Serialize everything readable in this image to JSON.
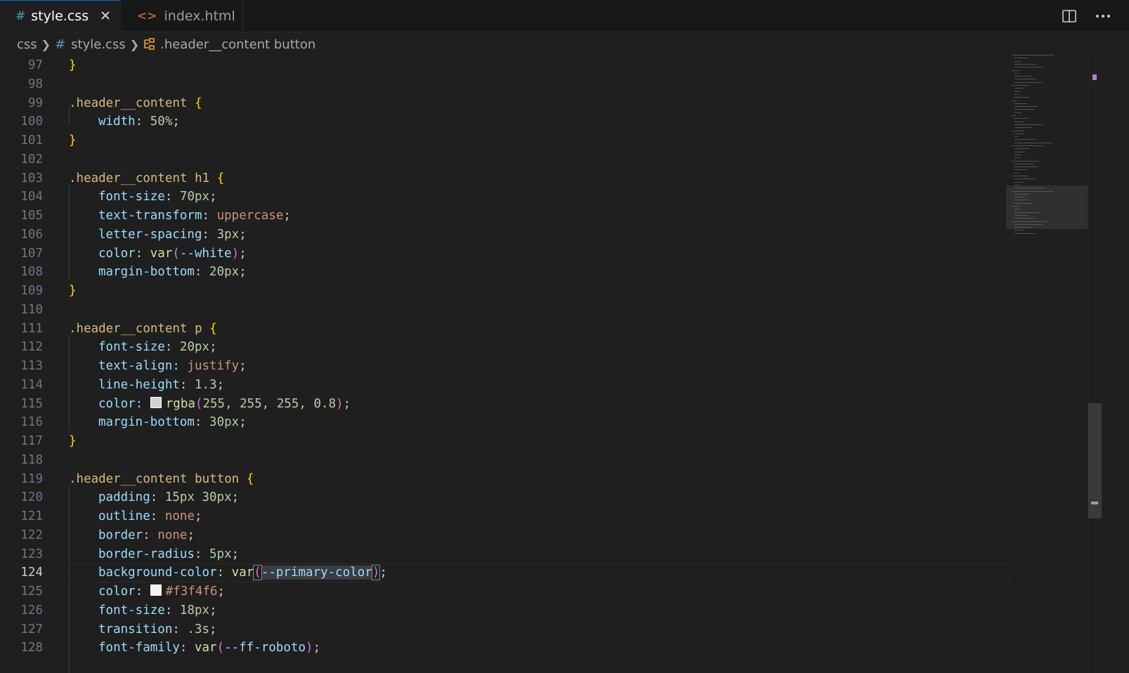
{
  "tabs": [
    {
      "icon": "#",
      "label": "style.css",
      "active": true
    },
    {
      "icon": "<>",
      "label": "index.html",
      "active": false
    }
  ],
  "breadcrumb": {
    "folder": "css",
    "file": "style.css",
    "symbol": ".header__content button"
  },
  "current_line": 124,
  "line_numbers": [
    "97",
    "98",
    "99",
    "100",
    "101",
    "102",
    "103",
    "104",
    "105",
    "106",
    "107",
    "108",
    "109",
    "110",
    "111",
    "112",
    "113",
    "114",
    "115",
    "116",
    "117",
    "118",
    "119",
    "120",
    "121",
    "122",
    "123",
    "124",
    "125",
    "126",
    "127",
    "128"
  ],
  "code": {
    "l97": "}",
    "l99_sel": ".header__content",
    "l100_prop": "width",
    "l100_val": "50%",
    "l101": "}",
    "l103_sel": ".header__content h1",
    "l104_prop": "font-size",
    "l104_val": "70px",
    "l105_prop": "text-transform",
    "l105_val": "uppercase",
    "l106_prop": "letter-spacing",
    "l106_val": "3px",
    "l107_prop": "color",
    "l107_fn": "var",
    "l107_arg": "--white",
    "l108_prop": "margin-bottom",
    "l108_val": "20px",
    "l109": "}",
    "l111_sel": ".header__content p",
    "l112_prop": "font-size",
    "l112_val": "20px",
    "l113_prop": "text-align",
    "l113_val": "justify",
    "l114_prop": "line-height",
    "l114_val": "1.3",
    "l115_prop": "color",
    "l115_fn": "rgba",
    "l115_args": "255, 255, 255, 0.8",
    "l116_prop": "margin-bottom",
    "l116_val": "30px",
    "l117": "}",
    "l119_sel": ".header__content button",
    "l120_prop": "padding",
    "l120_val": "15px 30px",
    "l121_prop": "outline",
    "l121_val": "none",
    "l122_prop": "border",
    "l122_val": "none",
    "l123_prop": "border-radius",
    "l123_val": "5px",
    "l124_prop": "background-color",
    "l124_fn": "var",
    "l124_arg": "--primary-color",
    "l125_prop": "color",
    "l125_val": "#f3f4f6",
    "l126_prop": "font-size",
    "l126_val": "18px",
    "l127_prop": "transition",
    "l127_val": ".3s",
    "l128_prop": "font-family",
    "l128_fn": "var",
    "l128_arg": "--ff-roboto"
  },
  "colors": {
    "editor_bg": "#1f1f1f",
    "selector": "#d7ba7d",
    "property": "#9cdcfe",
    "number": "#b5cea8",
    "keyword": "#ce9178",
    "function": "#dcdcaa",
    "brace": "#ffd700",
    "paren": "#da70d6",
    "swatch_115": "rgba(255,255,255,0.8)",
    "swatch_125": "#f3f4f6"
  },
  "icons": {
    "css_tab": "hash-icon",
    "html_tab": "code-brackets-icon",
    "close": "close-icon",
    "split": "split-editor-icon",
    "more": "more-actions-icon",
    "breadcrumb_symbol": "symbol-class-icon"
  }
}
